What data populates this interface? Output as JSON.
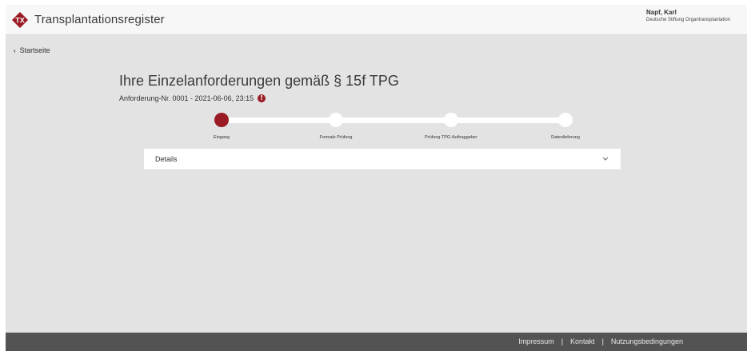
{
  "header": {
    "app_title": "Transplantationsregister",
    "logo_text": "TX",
    "user_name": "Napf, Karl",
    "user_org": "Deutsche Stiftung Organtransplantation"
  },
  "nav": {
    "back_label": "Startseite"
  },
  "main": {
    "title": "Ihre Einzelanforderungen gemäß § 15f TPG",
    "request_line": "Anforderung-Nr. 0001 - 2021-06-06, 23:15",
    "info_icon": "info-icon"
  },
  "stepper": {
    "current_step": 0,
    "steps": [
      {
        "label": "Eingang"
      },
      {
        "label": "Formale Prüfung"
      },
      {
        "label": "Prüfung TPG-Auftraggeber"
      },
      {
        "label": "Datenlieferung"
      }
    ]
  },
  "details": {
    "label": "Details",
    "icon": "chevron-down-icon"
  },
  "footer": {
    "links": [
      "Impressum",
      "Kontakt",
      "Nutzungsbedingungen"
    ],
    "separator": "|"
  },
  "colors": {
    "accent": "#9a1b23",
    "footer_bg": "#535353",
    "page_bg": "#e3e3e3"
  }
}
